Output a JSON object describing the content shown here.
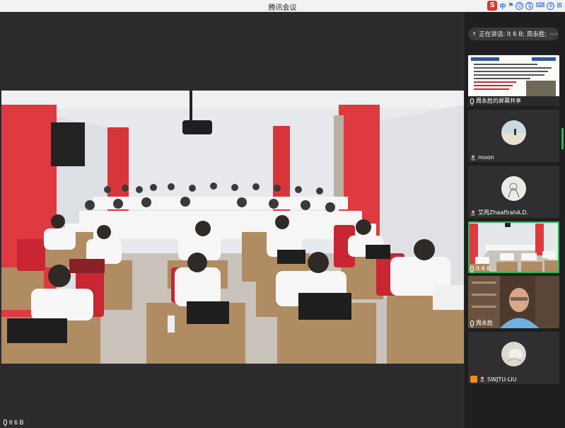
{
  "window": {
    "title": "腾讯会议"
  },
  "tray": {
    "s_badge": "S",
    "items": [
      "中",
      "⚑",
      "☺",
      "🎙",
      "⌨",
      "⚙",
      "⊞"
    ]
  },
  "speaking": {
    "text": "正在讲话: lt 6 B; 周永胜;"
  },
  "main_video": {
    "label": "lt 6 B"
  },
  "participants": [
    {
      "name": "周永胜的屏幕共享",
      "kind": "screen-share",
      "active": false
    },
    {
      "name": "moon",
      "kind": "avatar",
      "active": false
    },
    {
      "name": "艾丙ZhaafirahA.D.",
      "kind": "avatar",
      "active": false
    },
    {
      "name": "lt 6 B",
      "kind": "video",
      "active": true
    },
    {
      "name": "周永胜",
      "kind": "video",
      "active": false
    },
    {
      "name": "SWJTU-LIU",
      "kind": "avatar",
      "active": false
    }
  ],
  "colors": {
    "accent_green": "#2fb45a",
    "pillar_red": "#e0343a",
    "share_orange": "#f08a24"
  }
}
